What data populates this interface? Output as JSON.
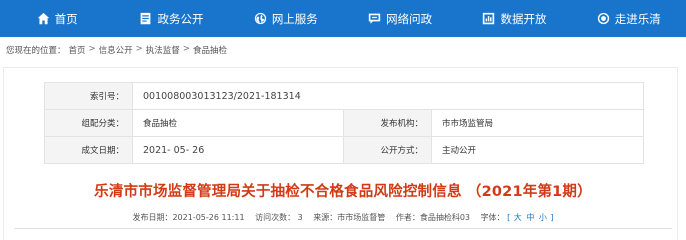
{
  "nav": {
    "items": [
      {
        "label": "首页",
        "icon": "home-icon"
      },
      {
        "label": "政务公开",
        "icon": "document-icon"
      },
      {
        "label": "网上服务",
        "icon": "globe-icon"
      },
      {
        "label": "网络问政",
        "icon": "chat-icon"
      },
      {
        "label": "数据开放",
        "icon": "data-icon"
      },
      {
        "label": "走进乐清",
        "icon": "target-icon"
      }
    ],
    "bg_color": "#1975cc"
  },
  "breadcrumb": {
    "prefix": "您现在的位置：",
    "items": [
      "首页",
      "信息公开",
      "执法监督",
      "食品抽检"
    ],
    "separator": ">"
  },
  "meta": {
    "index_label": "索引号：",
    "index_value": "001008003013123/2021-181314",
    "category_label": "组配分类：",
    "category_value": "食品抽检",
    "publisher_label": "发布机构：",
    "publisher_value": "市市场监管局",
    "date_label": "成文日期：",
    "date_value": "2021- 05- 26",
    "method_label": "公开方式：",
    "method_value": "主动公开"
  },
  "article": {
    "title": "乐清市市场监督管理局关于抽检不合格食品风险控制信息 （2021年第1期）",
    "title_color": "#d23a17",
    "publish_time": "发布日期：2021-05-26 11:11",
    "views": "访问次数：  3",
    "source": "来源：市市场监督管",
    "author": "作者：食品抽检科03",
    "font_label": "字体：",
    "font_open": "[",
    "font_large": "大",
    "font_medium": "中",
    "font_small": "小",
    "font_close": "]"
  }
}
